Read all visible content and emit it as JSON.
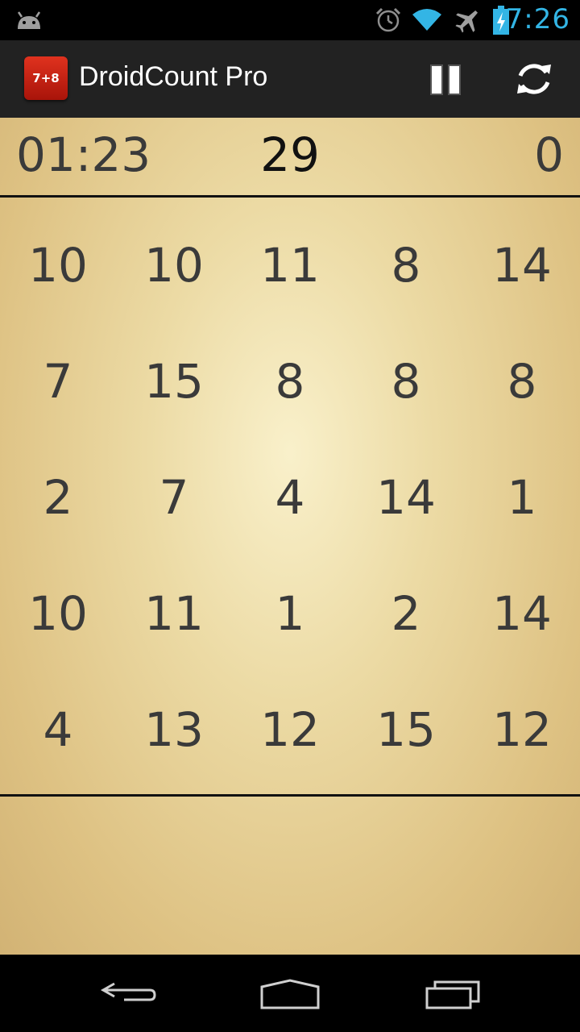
{
  "status_bar": {
    "time": "7:26",
    "icons": [
      "android-icon",
      "alarm-icon",
      "wifi-icon",
      "airplane-icon",
      "battery-charging-icon"
    ]
  },
  "action_bar": {
    "app_icon_text": "7+8",
    "title": "DroidCount Pro",
    "actions": [
      "pause-icon",
      "refresh-icon"
    ]
  },
  "game": {
    "timer": "01:23",
    "target": "29",
    "score": "0",
    "grid": [
      [
        "10",
        "10",
        "11",
        "8",
        "14"
      ],
      [
        "7",
        "15",
        "8",
        "8",
        "8"
      ],
      [
        "2",
        "7",
        "4",
        "14",
        "1"
      ],
      [
        "10",
        "11",
        "1",
        "2",
        "14"
      ],
      [
        "4",
        "13",
        "12",
        "15",
        "12"
      ]
    ]
  },
  "nav_bar": {
    "buttons": [
      "back-icon",
      "home-icon",
      "recent-apps-icon"
    ]
  },
  "colors": {
    "status_accent": "#33b5e5",
    "action_bar_bg": "#222222",
    "number_text": "#3a3a3a",
    "parchment": "#e7d29c"
  }
}
